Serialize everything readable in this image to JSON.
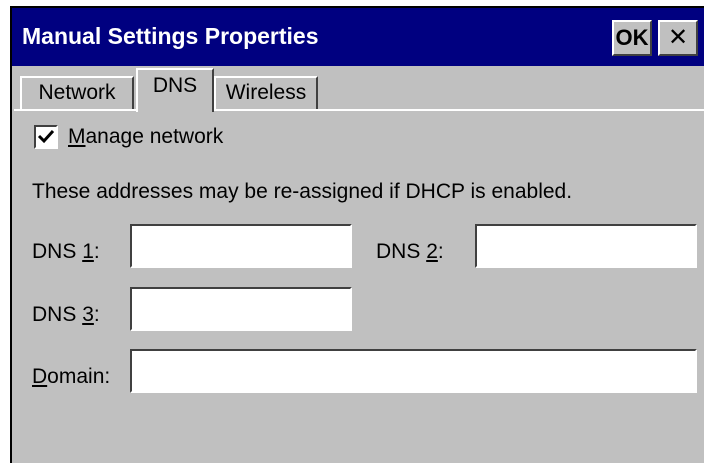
{
  "window": {
    "title": "Manual Settings Properties",
    "ok_label": "OK",
    "close_label": "✕"
  },
  "tabs": [
    {
      "label": "Network",
      "selected": false
    },
    {
      "label": "DNS",
      "selected": true
    },
    {
      "label": "Wireless",
      "selected": false
    }
  ],
  "manage_network": {
    "checked": true,
    "label_accel": "M",
    "label_rest": "anage network"
  },
  "info_text": "These addresses may be re-assigned if DHCP is enabled.",
  "fields": {
    "dns1": {
      "prefix": "DNS ",
      "accel": "1",
      "suffix": ":",
      "value": ""
    },
    "dns2": {
      "prefix": "DNS ",
      "accel": "2",
      "suffix": ":",
      "value": ""
    },
    "dns3": {
      "prefix": "DNS ",
      "accel": "3",
      "suffix": ":",
      "value": ""
    },
    "domain": {
      "prefix": "",
      "accel": "D",
      "suffix": "omain:",
      "value": ""
    }
  },
  "colors": {
    "titlebar": "#000080",
    "face": "#c0c0c0"
  }
}
